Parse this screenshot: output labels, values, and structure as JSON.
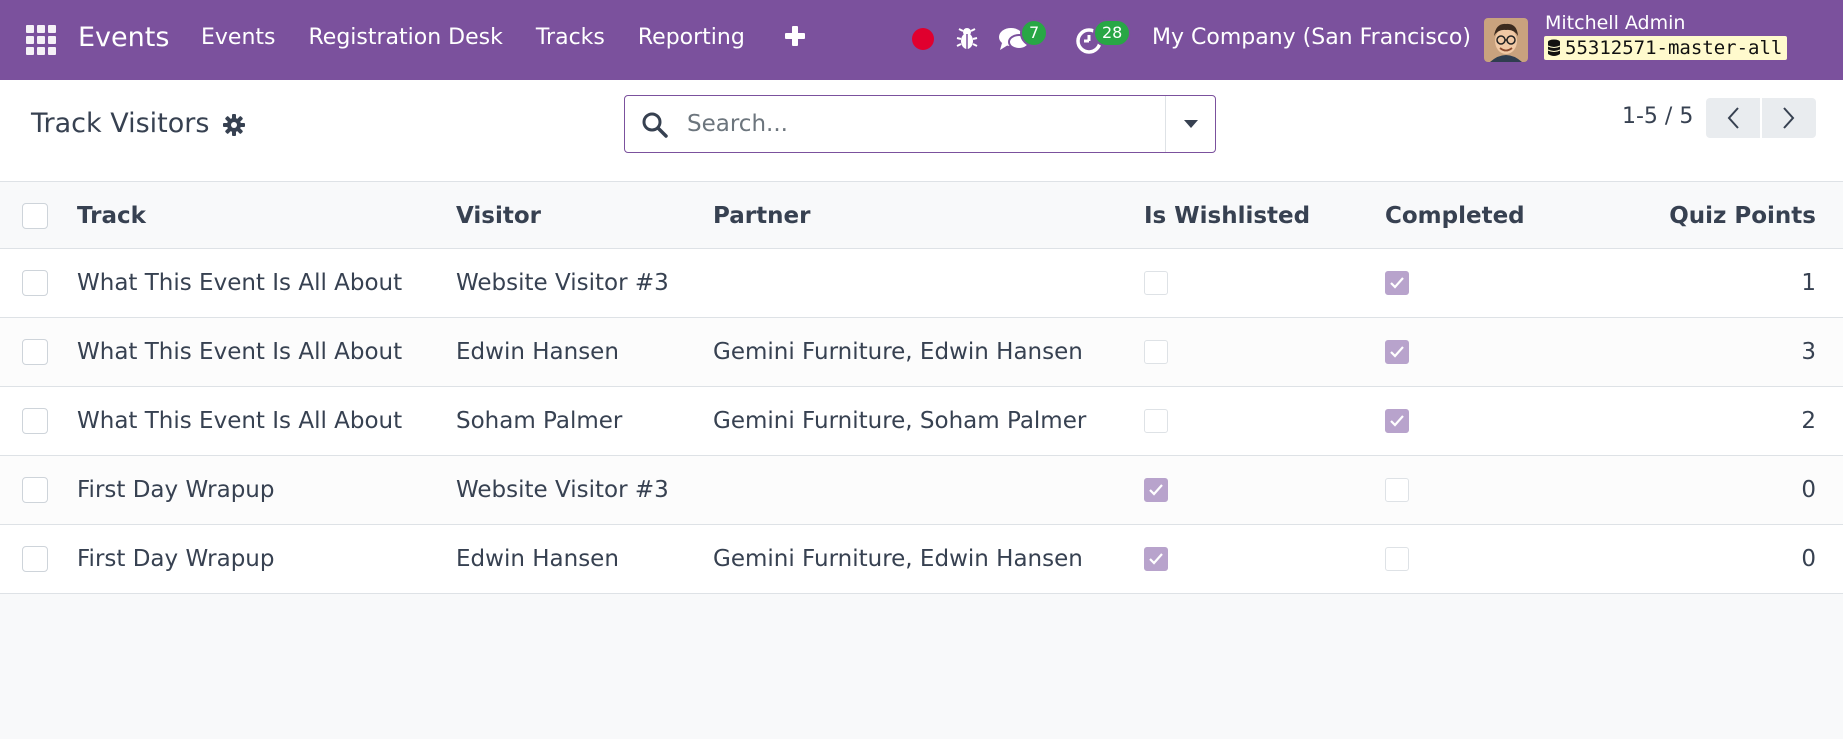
{
  "navbar": {
    "app_name": "Events",
    "menu": [
      "Events",
      "Registration Desk",
      "Tracks",
      "Reporting"
    ],
    "messages_count": "7",
    "activities_count": "28",
    "company": "My Company (San Francisco)",
    "user_name": "Mitchell Admin",
    "database": "55312571-master-all",
    "accent_color": "#7b519d"
  },
  "control": {
    "title": "Track Visitors",
    "search_placeholder": "Search...",
    "pager": "1-5 / 5"
  },
  "table": {
    "columns": {
      "track": "Track",
      "visitor": "Visitor",
      "partner": "Partner",
      "wishlisted": "Is Wishlisted",
      "completed": "Completed",
      "points": "Quiz Points"
    },
    "rows": [
      {
        "track": "What This Event Is All About",
        "visitor": "Website Visitor #3",
        "partner": "",
        "wishlisted": false,
        "completed": true,
        "points": "1"
      },
      {
        "track": "What This Event Is All About",
        "visitor": "Edwin Hansen",
        "partner": "Gemini Furniture, Edwin Hansen",
        "wishlisted": false,
        "completed": true,
        "points": "3"
      },
      {
        "track": "What This Event Is All About",
        "visitor": "Soham Palmer",
        "partner": "Gemini Furniture, Soham Palmer",
        "wishlisted": false,
        "completed": true,
        "points": "2"
      },
      {
        "track": "First Day Wrapup",
        "visitor": "Website Visitor #3",
        "partner": "",
        "wishlisted": true,
        "completed": false,
        "points": "0"
      },
      {
        "track": "First Day Wrapup",
        "visitor": "Edwin Hansen",
        "partner": "Gemini Furniture, Edwin Hansen",
        "wishlisted": true,
        "completed": false,
        "points": "0"
      }
    ]
  }
}
